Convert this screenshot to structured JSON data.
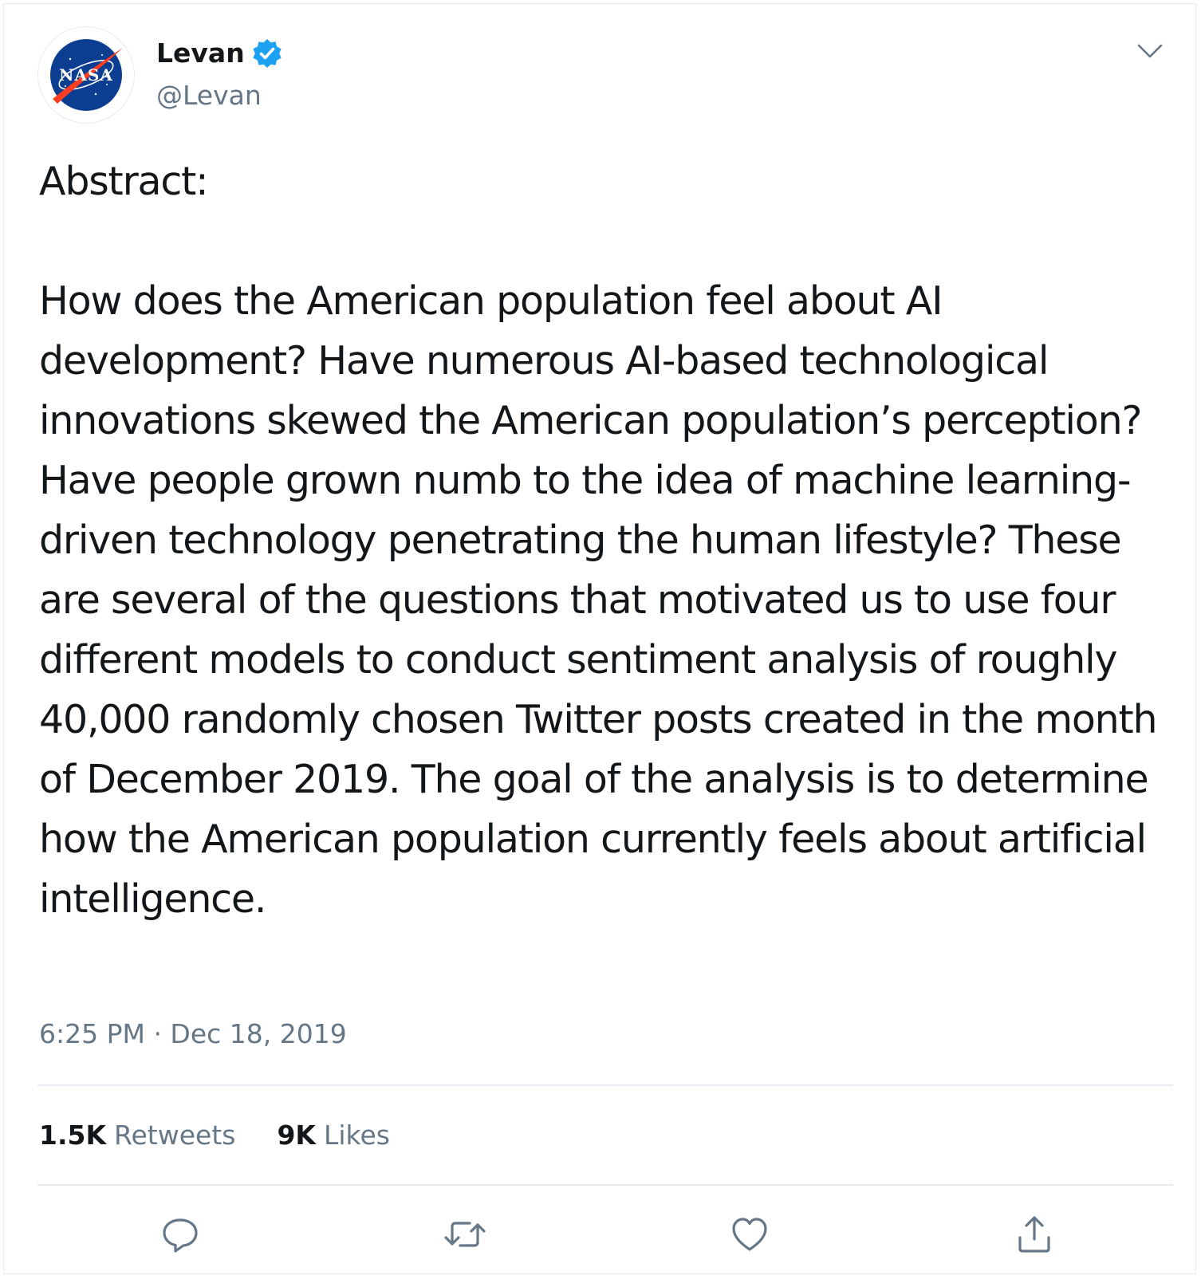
{
  "author": {
    "display_name": "Levan",
    "handle": "@Levan",
    "avatar_logo_text": "NASA",
    "verified": true
  },
  "tweet": {
    "heading": "Abstract:",
    "body": "How does the American population feel about AI development? Have numerous AI-based technological innovations skewed the American population’s perception? Have people grown numb to the idea of machine learning-driven technology penetrating the human lifestyle? These are several of the questions that motivated us to use four different models to conduct sentiment analysis of roughly 40,000 randomly chosen Twitter posts created in the month of December 2019. The goal of the analysis is to determine how the American population currently feels about artificial intelligence.",
    "timestamp": "6:25 PM · Dec 18, 2019"
  },
  "stats": {
    "retweets_count": "1.5K",
    "retweets_label": "Retweets",
    "likes_count": "9K",
    "likes_label": "Likes"
  },
  "actions": {
    "icons": [
      "reply-icon",
      "retweet-icon",
      "like-icon",
      "share-icon"
    ]
  },
  "colors": {
    "text_primary": "#14171a",
    "text_secondary": "#657786",
    "border": "#e6ecf0",
    "verified_blue": "#1da1f2",
    "nasa_blue": "#0b3d91",
    "nasa_red": "#fc3d21"
  }
}
